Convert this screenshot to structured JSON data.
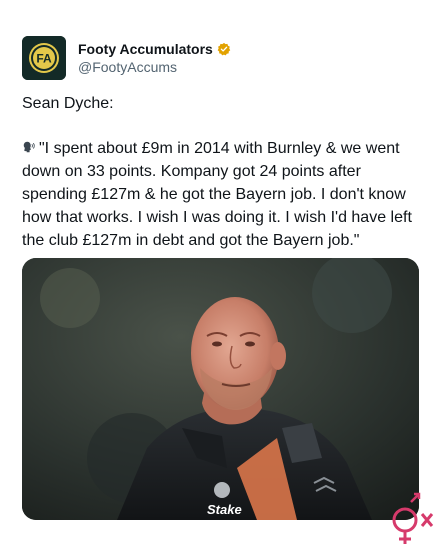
{
  "account": {
    "display_name": "Footy Accumulators",
    "handle": "@FootyAccums",
    "avatar_monogram": "FA",
    "verified_badge_color": "#e2a200"
  },
  "tweet": {
    "line1": "Sean Dyche:",
    "speaker_icon": "speaking-head-icon",
    "quote": "\"I spent about £9m in 2014 with Burnley & we went down on 33 points. Kompany got 24 points after spending £127m & he got the Bayern job. I don't know how that works. I wish I was doing it. I wish I'd have left the club £127m in debt and got the Bayern job.\""
  },
  "media": {
    "sponsor_text": "Stake"
  },
  "colors": {
    "text_primary": "#0f1419",
    "text_secondary": "#536471",
    "avatar_bg": "#132a27",
    "avatar_accent": "#e3c84a",
    "watermark": "#d63a6b"
  }
}
